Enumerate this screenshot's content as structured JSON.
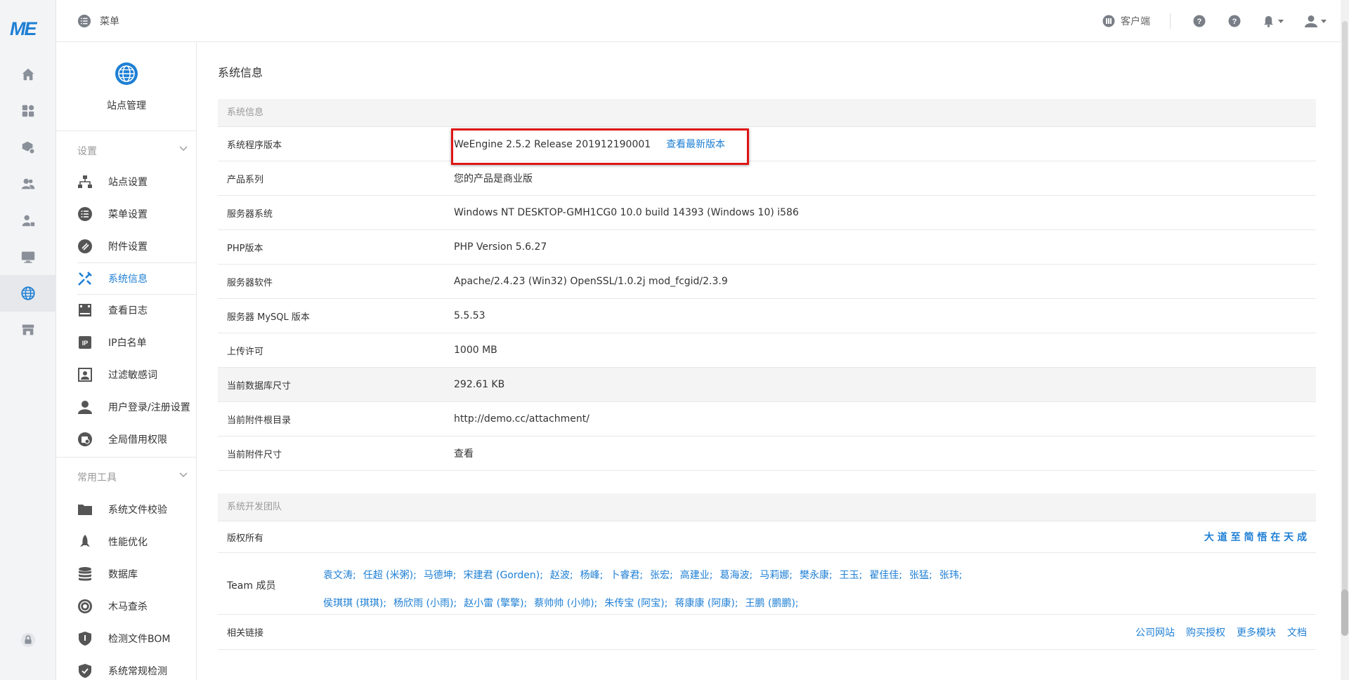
{
  "logo": "ME",
  "topbar": {
    "menu_label": "菜单",
    "client_label": "客户端"
  },
  "sidebar": {
    "site_label": "站点管理",
    "group_settings": "设置",
    "settings_items": [
      {
        "label": "站点设置",
        "icon": "sitemap-icon"
      },
      {
        "label": "菜单设置",
        "icon": "menu-list-icon"
      },
      {
        "label": "附件设置",
        "icon": "attachment-icon"
      },
      {
        "label": "系统信息",
        "icon": "wrench-icon",
        "active": true
      },
      {
        "label": "查看日志",
        "icon": "log-icon"
      },
      {
        "label": "IP白名单",
        "icon": "ip-icon"
      },
      {
        "label": "过滤敏感词",
        "icon": "filter-icon"
      },
      {
        "label": "用户登录/注册设置",
        "icon": "user-icon"
      },
      {
        "label": "全局借用权限",
        "icon": "permission-icon"
      }
    ],
    "group_tools": "常用工具",
    "tools_items": [
      {
        "label": "系统文件校验",
        "icon": "folder-icon"
      },
      {
        "label": "性能优化",
        "icon": "rocket-icon"
      },
      {
        "label": "数据库",
        "icon": "database-icon"
      },
      {
        "label": "木马查杀",
        "icon": "target-icon"
      },
      {
        "label": "检测文件BOM",
        "icon": "shield-icon"
      },
      {
        "label": "系统常规检测",
        "icon": "shield-check-icon"
      }
    ]
  },
  "page": {
    "title": "系统信息",
    "sysinfo_head": "系统信息",
    "rows": [
      {
        "key": "系统程序版本",
        "value": "WeEngine 2.5.2 Release 201912190001",
        "link": "查看最新版本"
      },
      {
        "key": "产品系列",
        "value": "您的产品是商业版"
      },
      {
        "key": "服务器系统",
        "value": "Windows NT DESKTOP-GMH1CG0 10.0 build 14393 (Windows 10) i586"
      },
      {
        "key": "PHP版本",
        "value": "PHP Version 5.6.27"
      },
      {
        "key": "服务器软件",
        "value": "Apache/2.4.23 (Win32) OpenSSL/1.0.2j mod_fcgid/2.3.9"
      },
      {
        "key": "服务器 MySQL 版本",
        "value": "5.5.53"
      },
      {
        "key": "上传许可",
        "value": "1000 MB"
      },
      {
        "key": "当前数据库尺寸",
        "value": "292.61 KB"
      },
      {
        "key": "当前附件根目录",
        "value": "http://demo.cc/attachment/"
      },
      {
        "key": "当前附件尺寸",
        "link": "查看"
      }
    ],
    "team_head": "系统开发团队",
    "copyright_key": "版权所有",
    "copyright_value": "大 道 至 简 悟 在 天 成",
    "team_key": "Team 成员",
    "team_line1": [
      "袁文涛;",
      "任超 (米粥);",
      "马德坤;",
      "宋建君 (Gorden);",
      "赵波;",
      "杨峰;",
      "卜睿君;",
      "张宏;",
      "高建业;",
      "葛海波;",
      "马莉娜;",
      "樊永康;",
      "王玉;",
      "翟佳佳;",
      "张猛;",
      "张玮;"
    ],
    "team_line2": [
      "侯琪琪 (琪琪);",
      "杨欣雨 (小雨);",
      "赵小雷 (擎擎);",
      "蔡帅帅 (小帅);",
      "朱传宝 (阿宝);",
      "蒋康康 (阿康);",
      "王鹏 (鹏鹏);"
    ],
    "links_key": "相关链接",
    "links": [
      "公司网站",
      "购买授权",
      "更多模块",
      "文档"
    ]
  }
}
